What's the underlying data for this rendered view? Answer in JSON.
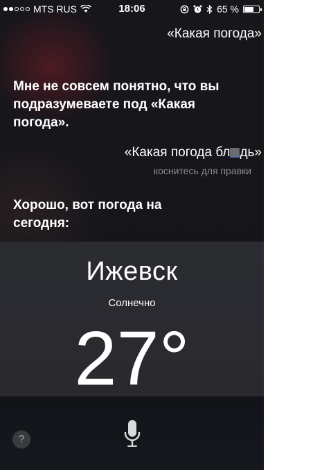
{
  "status_bar": {
    "carrier": "MTS RUS",
    "time": "18:06",
    "battery": "65 %",
    "battery_level": 0.65,
    "icons": [
      "signal-dots-icon",
      "wifi-icon",
      "rotation-lock-icon",
      "alarm-icon",
      "bluetooth-icon",
      "battery-icon"
    ]
  },
  "conversation": {
    "user_query_1": "«Какая погода»",
    "siri_reply_1": "Мне не совсем понятно, что вы подразумеваете под «Какая погода».",
    "user_query_2_prefix": "«Какая погода бл",
    "user_query_2_suffix": "дь»",
    "tap_to_edit": "коснитесь для правки",
    "siri_reply_2": "Хорошо, вот погода на сегодня:"
  },
  "weather": {
    "city": "Ижевск",
    "condition": "Солнечно",
    "temperature": "27°"
  },
  "bottom": {
    "help_label": "?",
    "mic_icon": "microphone-icon"
  }
}
